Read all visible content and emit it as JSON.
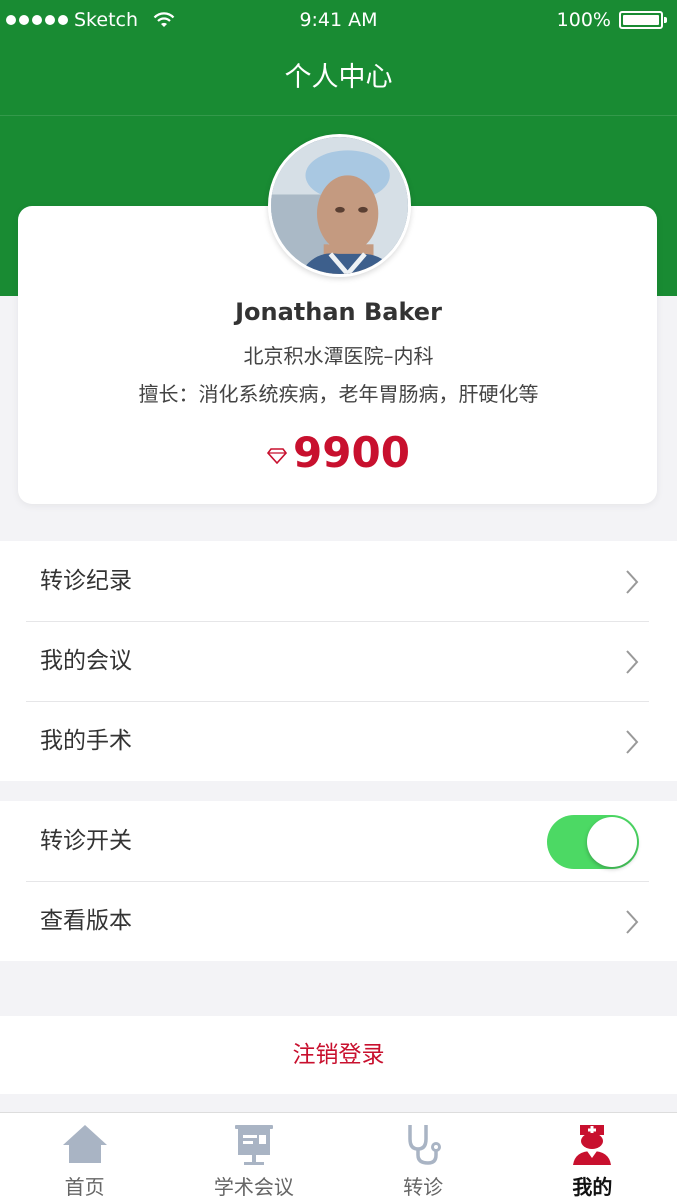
{
  "status_bar": {
    "carrier": "Sketch",
    "time": "9:41 AM",
    "battery": "100%"
  },
  "nav": {
    "title": "个人中心"
  },
  "profile": {
    "name": "Jonathan Baker",
    "hospital": "北京积水潭医院–内科",
    "specialty": "擅长：消化系统疾病，老年胃肠病，肝硬化等",
    "points": "9900"
  },
  "menu_group_1": [
    {
      "label": "转诊纪录"
    },
    {
      "label": "我的会议"
    },
    {
      "label": "我的手术"
    }
  ],
  "menu_group_2": {
    "referral_switch_label": "转诊开关",
    "referral_switch_on": true,
    "version_label": "查看版本"
  },
  "logout_label": "注销登录",
  "tabs": [
    {
      "label": "首页",
      "icon": "home-icon",
      "active": false
    },
    {
      "label": "学术会议",
      "icon": "conference-icon",
      "active": false
    },
    {
      "label": "转诊",
      "icon": "stethoscope-icon",
      "active": false
    },
    {
      "label": "我的",
      "icon": "nurse-icon",
      "active": true
    }
  ],
  "colors": {
    "brand_green": "#198b33",
    "accent_red": "#c8102e",
    "toggle_green": "#4cd964",
    "tab_inactive_icon": "#a9b4c4"
  }
}
